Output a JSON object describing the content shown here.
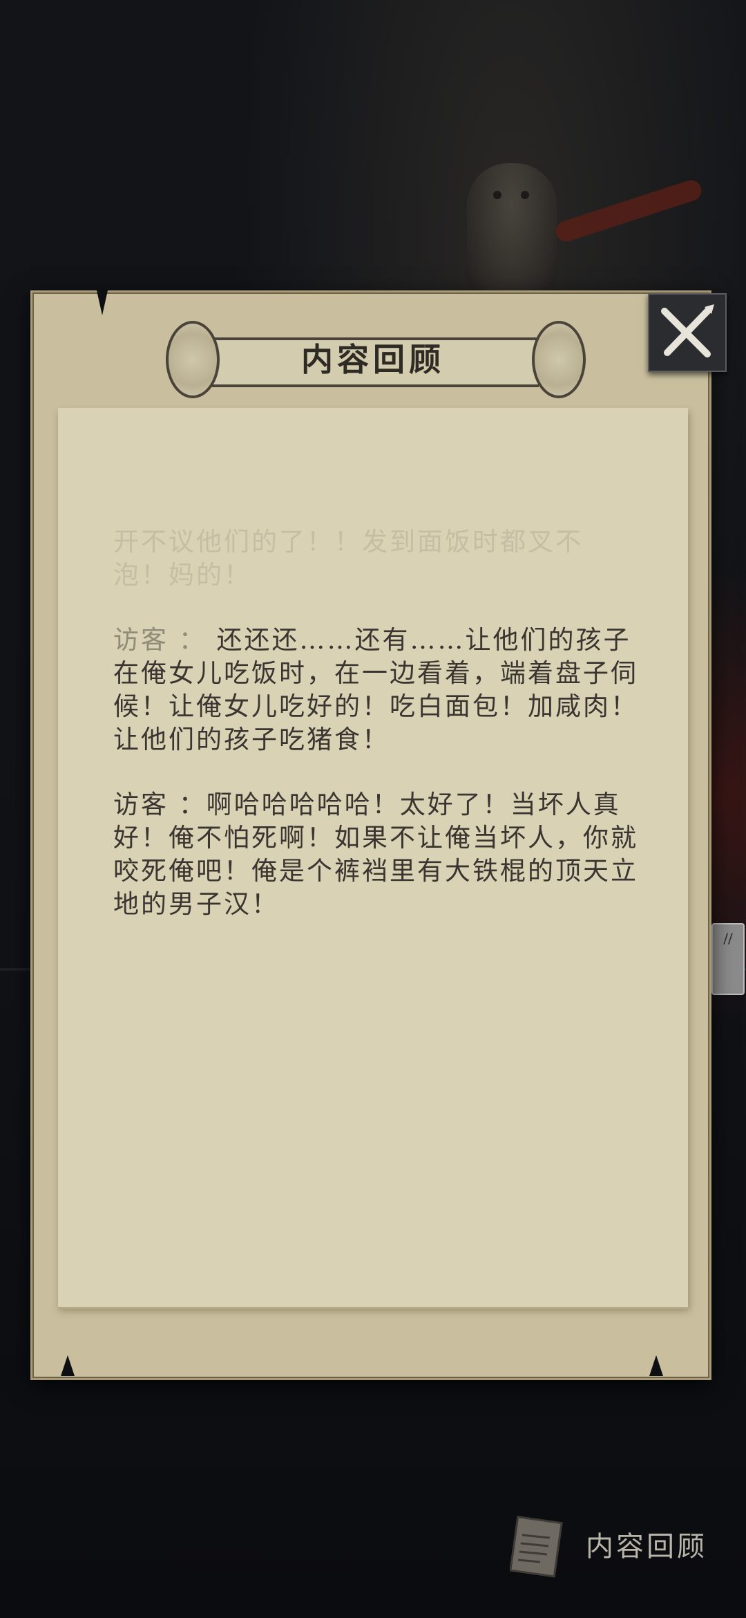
{
  "dialog": {
    "title": "内容回顾",
    "entries": [
      {
        "speaker": "",
        "text": "开不议他们的了！！发到面饭时都叉不",
        "fade": "strong"
      },
      {
        "speaker": "",
        "text": "泡！妈的！",
        "fade": "strong"
      },
      {
        "speaker": "访客",
        "text": "还还还……还有……让他们的孩子在俺女儿吃饭时，在一边看着，端着盘子伺候！让俺女儿吃好的！吃白面包！加咸肉！让他们的孩子吃猪食！",
        "fade": "partial"
      },
      {
        "speaker": "访客",
        "text": "啊哈哈哈哈哈！太好了！当坏人真好！俺不怕死啊！如果不让俺当坏人，你就咬死俺吧！俺是个裤裆里有大铁棍的顶天立地的男子汉！",
        "fade": "none"
      }
    ]
  },
  "close_button": {
    "icon": "crossed-quills-close-icon"
  },
  "review_button": {
    "label": "内容回顾",
    "icon": "scroll-paper-icon"
  },
  "colors": {
    "background": "#0d0f12",
    "parchment": "#c9bf9e",
    "sheet": "#d9d2b4",
    "text": "#3a3530"
  }
}
